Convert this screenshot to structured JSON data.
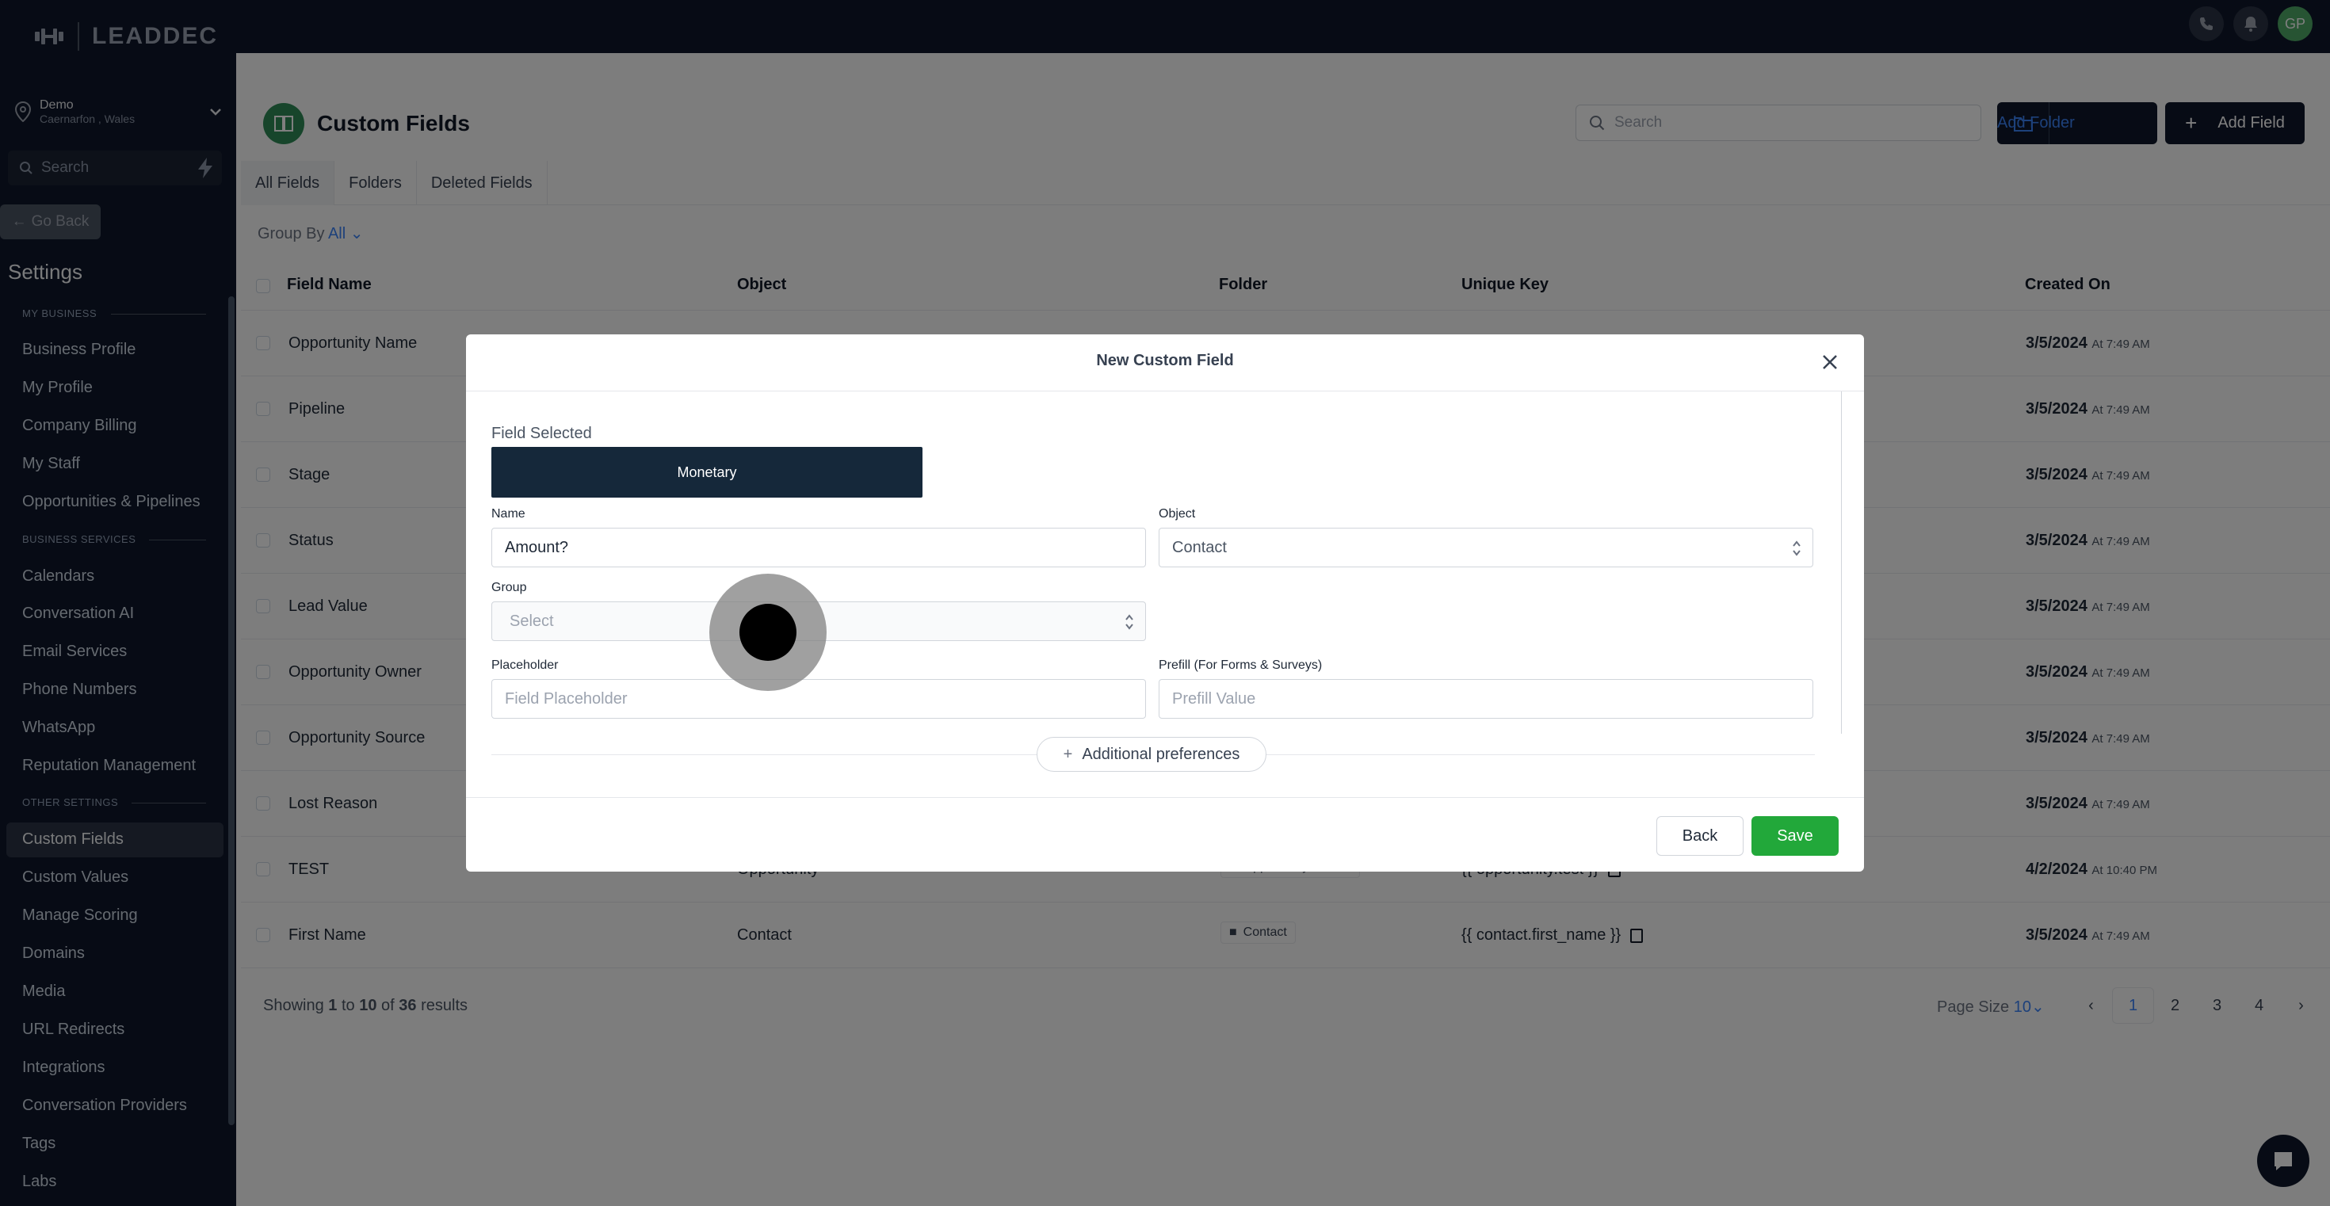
{
  "app": {
    "logo_text": "LEADDEC",
    "user_initials": "GP"
  },
  "location": {
    "name": "Demo",
    "address": "Caernarfon , Wales"
  },
  "sidebar": {
    "search_placeholder": "Search",
    "go_back": "Go Back",
    "title": "Settings",
    "sections": [
      {
        "label": "MY BUSINESS"
      },
      {
        "label": "BUSINESS SERVICES"
      },
      {
        "label": "OTHER SETTINGS"
      }
    ],
    "items": [
      {
        "label": "Business Profile"
      },
      {
        "label": "My Profile"
      },
      {
        "label": "Company Billing"
      },
      {
        "label": "My Staff"
      },
      {
        "label": "Opportunities & Pipelines"
      },
      {
        "label": "Calendars"
      },
      {
        "label": "Conversation AI"
      },
      {
        "label": "Email Services"
      },
      {
        "label": "Phone Numbers"
      },
      {
        "label": "WhatsApp"
      },
      {
        "label": "Reputation Management"
      },
      {
        "label": "Custom Fields"
      },
      {
        "label": "Custom Values"
      },
      {
        "label": "Manage Scoring"
      },
      {
        "label": "Domains"
      },
      {
        "label": "Media"
      },
      {
        "label": "URL Redirects"
      },
      {
        "label": "Integrations"
      },
      {
        "label": "Conversation Providers"
      },
      {
        "label": "Tags"
      },
      {
        "label": "Labs"
      }
    ]
  },
  "page": {
    "title": "Custom Fields",
    "search_placeholder": "Search",
    "add_folder": "Add Folder",
    "add_field": "Add Field",
    "tabs": [
      {
        "label": "All Fields"
      },
      {
        "label": "Folders"
      },
      {
        "label": "Deleted Fields"
      }
    ],
    "group_by_label": "Group By",
    "group_by_value": "All"
  },
  "table": {
    "headers": {
      "field_name": "Field Name",
      "object": "Object",
      "folder": "Folder",
      "unique_key": "Unique Key",
      "created_on": "Created On"
    },
    "rows": [
      {
        "name": "Opportunity Name",
        "object": "",
        "folder": "",
        "key": "",
        "date": "3/5/2024",
        "time": "At 7:49 AM"
      },
      {
        "name": "Pipeline",
        "object": "",
        "folder": "",
        "key": "",
        "date": "3/5/2024",
        "time": "At 7:49 AM"
      },
      {
        "name": "Stage",
        "object": "",
        "folder": "",
        "key": "",
        "date": "3/5/2024",
        "time": "At 7:49 AM"
      },
      {
        "name": "Status",
        "object": "",
        "folder": "",
        "key": "",
        "date": "3/5/2024",
        "time": "At 7:49 AM"
      },
      {
        "name": "Lead Value",
        "object": "",
        "folder": "",
        "key": "",
        "date": "3/5/2024",
        "time": "At 7:49 AM"
      },
      {
        "name": "Opportunity Owner",
        "object": "",
        "folder": "",
        "key": "",
        "date": "3/5/2024",
        "time": "At 7:49 AM"
      },
      {
        "name": "Opportunity Source",
        "object": "",
        "folder": "",
        "key": "",
        "date": "3/5/2024",
        "time": "At 7:49 AM"
      },
      {
        "name": "Lost Reason",
        "object": "",
        "folder": "",
        "key": "",
        "date": "3/5/2024",
        "time": "At 7:49 AM"
      },
      {
        "name": "TEST",
        "object": "Opportunity",
        "folder": "Opportunity Details",
        "key": "{{ opportunity.test }}",
        "date": "4/2/2024",
        "time": "At 10:40 PM"
      },
      {
        "name": "First Name",
        "object": "Contact",
        "folder": "Contact",
        "key": "{{ contact.first_name }}",
        "date": "3/5/2024",
        "time": "At 7:49 AM"
      }
    ],
    "showing_prefix": "Showing",
    "showing_from": "1",
    "showing_to_word": "to",
    "showing_to": "10",
    "showing_of_word": "of",
    "showing_total": "36",
    "showing_suffix": "results",
    "page_size_label": "Page Size",
    "page_size_value": "10",
    "pages": [
      "1",
      "2",
      "3",
      "4"
    ],
    "current_page": "1"
  },
  "modal": {
    "title": "New Custom Field",
    "field_selected_label": "Field Selected",
    "field_type": "Monetary",
    "name_label": "Name",
    "name_value": "Amount?",
    "object_label": "Object",
    "object_value": "Contact",
    "group_label": "Group",
    "group_placeholder": "Select",
    "placeholder_label": "Placeholder",
    "placeholder_placeholder": "Field Placeholder",
    "prefill_label": "Prefill (For Forms & Surveys)",
    "prefill_placeholder": "Prefill Value",
    "additional_preferences": "Additional preferences",
    "back": "Back",
    "save": "Save"
  },
  "colors": {
    "sidebar_bg": "#0f172a",
    "accent_blue": "#3b82f6",
    "save_green": "#22a83a",
    "selected_type_bg": "#15283a"
  }
}
